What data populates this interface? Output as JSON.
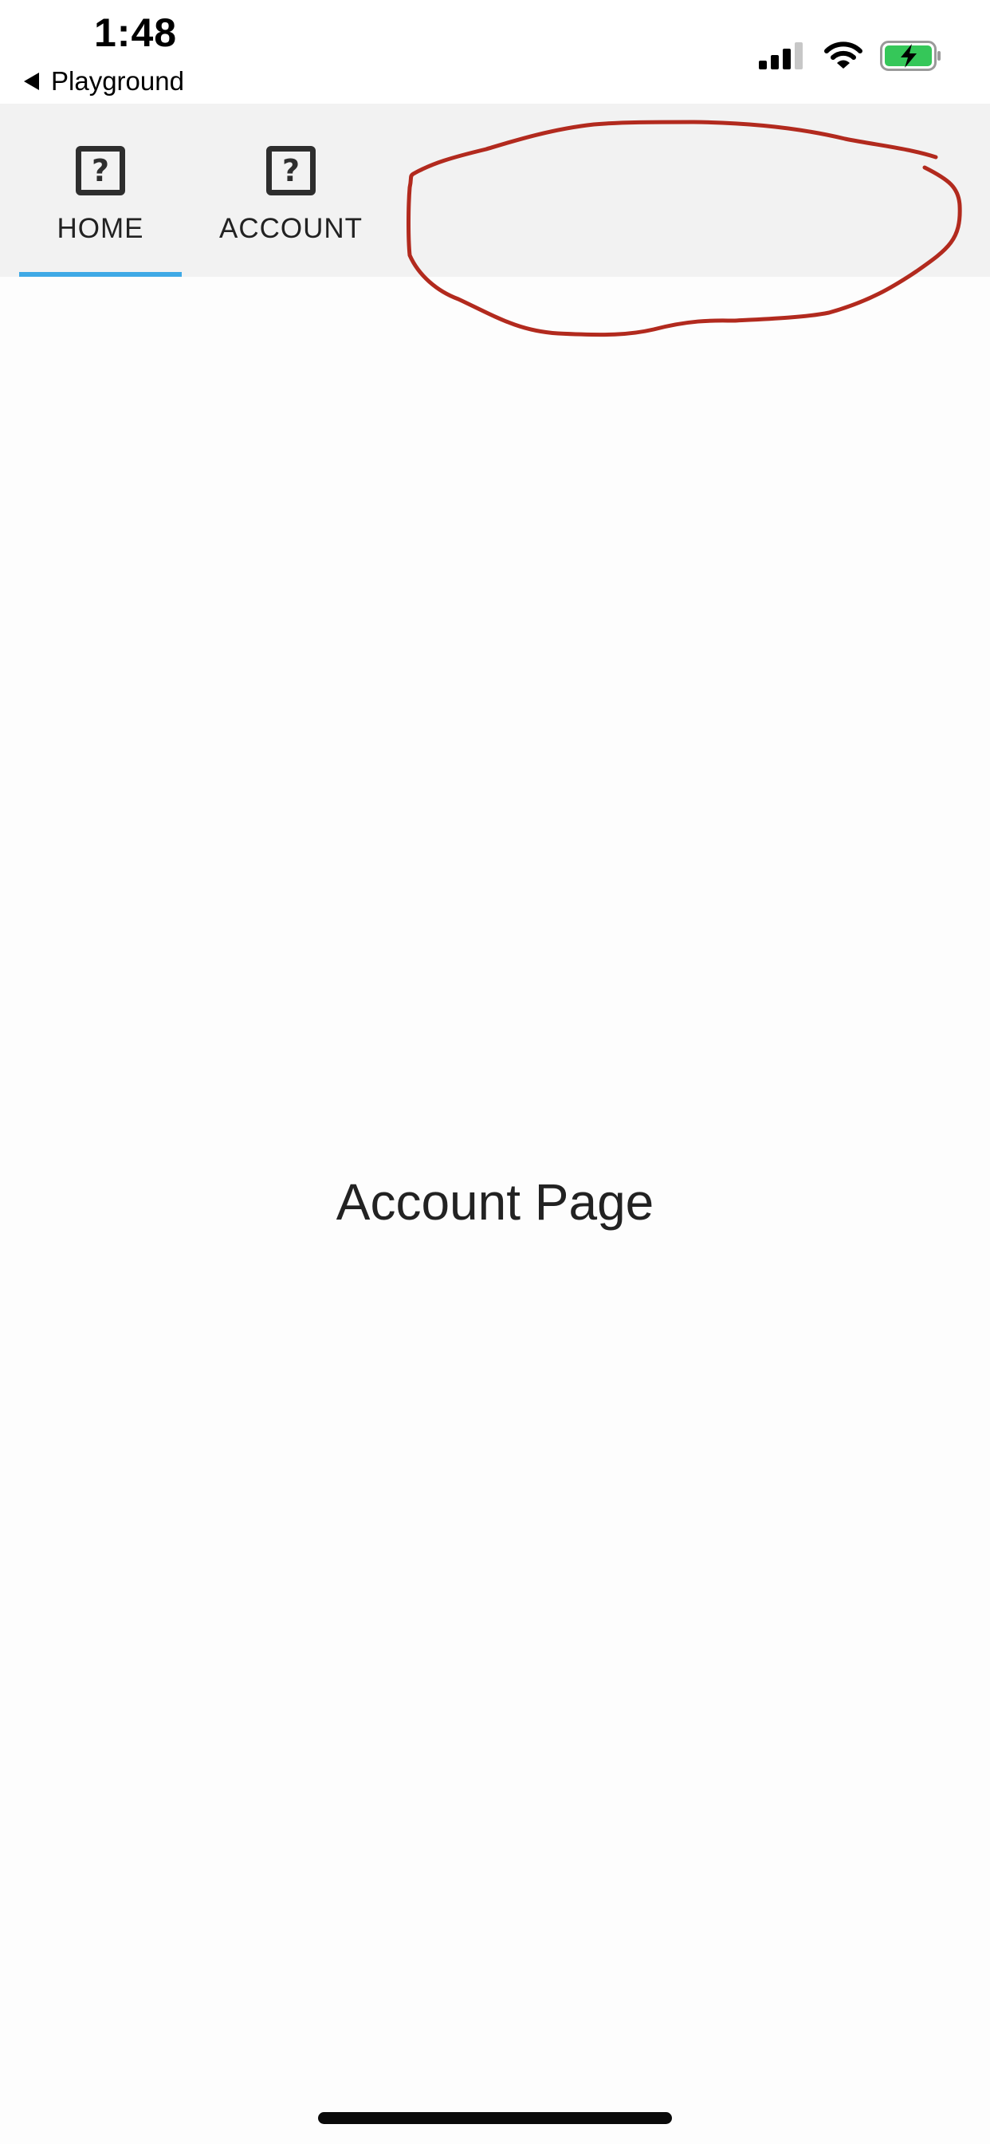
{
  "status_bar": {
    "time": "1:48",
    "back_app_label": "Playground",
    "icons": [
      "signal-icon",
      "wifi-icon",
      "battery-charging-icon"
    ],
    "battery_color": "#35c759"
  },
  "tabs": [
    {
      "label": "HOME",
      "icon": "question-mark-icon",
      "selected": true
    },
    {
      "label": "ACCOUNT",
      "icon": "question-mark-icon",
      "selected": false
    }
  ],
  "colors": {
    "tab_indicator": "#3fa9e6",
    "tab_bar_background": "#f2f2f2",
    "annotation_stroke": "#b22a1e"
  },
  "content": {
    "title": "Account Page"
  }
}
